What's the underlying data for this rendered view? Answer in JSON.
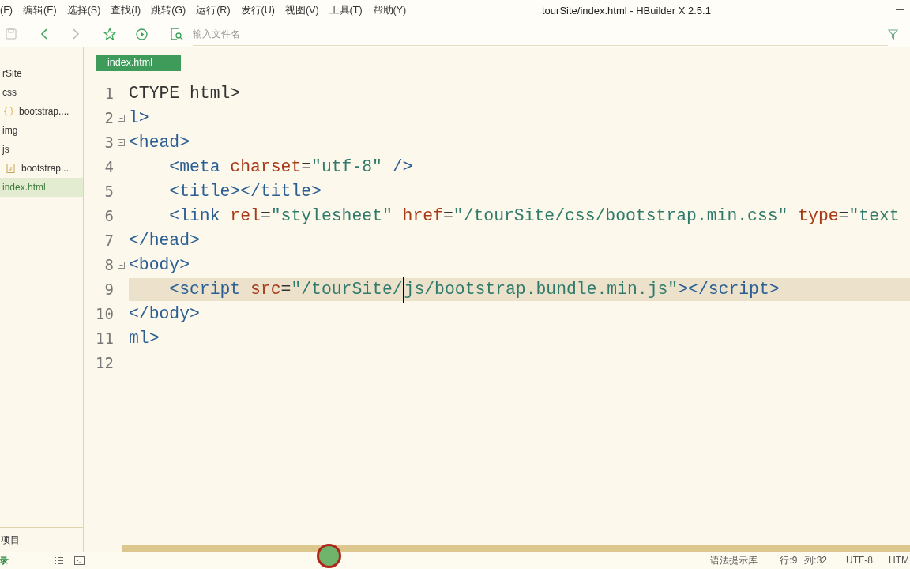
{
  "window": {
    "title": "tourSite/index.html - HBuilder X 2.5.1"
  },
  "menu": [
    "(F)",
    "编辑(E)",
    "选择(S)",
    "查找(I)",
    "跳转(G)",
    "运行(R)",
    "发行(U)",
    "视图(V)",
    "工具(T)",
    "帮助(Y)"
  ],
  "toolbar": {
    "items": [
      {
        "kind": "save",
        "disabled": true
      },
      {
        "kind": "back",
        "disabled": false
      },
      {
        "kind": "forward",
        "disabled": true
      },
      {
        "kind": "star",
        "disabled": false
      },
      {
        "kind": "run",
        "disabled": false
      }
    ],
    "search": {
      "placeholder": "输入文件名"
    }
  },
  "sidebar": {
    "tree": [
      {
        "label": "rSite",
        "selected": false,
        "children": [
          {
            "label": "css",
            "selected": false,
            "children": [
              {
                "label": "bootstrap....",
                "kind": "css",
                "selected": false
              }
            ]
          },
          {
            "label": "img",
            "selected": false
          },
          {
            "label": "js",
            "selected": false,
            "children": [
              {
                "label": "bootstrap....",
                "kind": "js",
                "selected": false
              }
            ]
          },
          {
            "label": "index.html",
            "selected": true
          }
        ]
      }
    ],
    "footer": "项目"
  },
  "editor": {
    "tabs": [
      {
        "label": "index.html",
        "selected": true
      }
    ],
    "lines": [
      {
        "number": "1",
        "fold": false,
        "current": false,
        "tokens": [
          {
            "t": "CTYPE html>",
            "kind": "plain"
          }
        ]
      },
      {
        "number": "2",
        "fold": true,
        "current": false,
        "tokens": [
          {
            "t": "l>",
            "kind": "tag"
          }
        ]
      },
      {
        "number": "3",
        "fold": true,
        "current": false,
        "tokens": [
          {
            "t": "<head>",
            "kind": "tag"
          }
        ]
      },
      {
        "number": "4",
        "fold": false,
        "current": false,
        "tokens": [
          {
            "t": "    <meta",
            "kind": "tag"
          },
          {
            "t": " charset",
            "kind": "attr"
          },
          {
            "t": "=",
            "kind": "plain"
          },
          {
            "t": "\"utf-8\"",
            "kind": "string"
          },
          {
            "t": " />",
            "kind": "tag"
          }
        ]
      },
      {
        "number": "5",
        "fold": false,
        "current": false,
        "tokens": [
          {
            "t": "    <title></title>",
            "kind": "tag"
          }
        ]
      },
      {
        "number": "6",
        "fold": false,
        "current": false,
        "tokens": [
          {
            "t": "    <link",
            "kind": "tag"
          },
          {
            "t": " rel",
            "kind": "attr"
          },
          {
            "t": "=",
            "kind": "plain"
          },
          {
            "t": "\"stylesheet\"",
            "kind": "string"
          },
          {
            "t": " href",
            "kind": "attr"
          },
          {
            "t": "=",
            "kind": "plain"
          },
          {
            "t": "\"/tourSite/css/bootstrap.min.css\"",
            "kind": "string"
          },
          {
            "t": " type",
            "kind": "attr"
          },
          {
            "t": "=",
            "kind": "plain"
          },
          {
            "t": "\"text",
            "kind": "string"
          }
        ]
      },
      {
        "number": "7",
        "fold": false,
        "current": false,
        "tokens": [
          {
            "t": "</head>",
            "kind": "tag"
          }
        ]
      },
      {
        "number": "8",
        "fold": true,
        "current": false,
        "tokens": [
          {
            "t": "<body>",
            "kind": "tag"
          }
        ]
      },
      {
        "number": "9",
        "fold": false,
        "current": true,
        "tokens": [
          {
            "t": "    <script",
            "kind": "tag",
            "caret": false
          },
          {
            "t": " src",
            "kind": "attr",
            "caret": false
          },
          {
            "t": "=",
            "kind": "plain",
            "caret": false
          },
          {
            "t": "\"/tourSite/",
            "kind": "string",
            "caret": true
          },
          {
            "t": "js/bootstrap.bundle.min.js\"",
            "kind": "string",
            "caret": false
          },
          {
            "t": "></script>",
            "kind": "tag",
            "caret": false
          }
        ]
      },
      {
        "number": "10",
        "fold": false,
        "current": false,
        "tokens": [
          {
            "t": "</body>",
            "kind": "tag"
          }
        ]
      },
      {
        "number": "11",
        "fold": false,
        "current": false,
        "tokens": [
          {
            "t": "ml>",
            "kind": "tag"
          }
        ]
      },
      {
        "number": "12",
        "fold": false,
        "current": false
      }
    ]
  },
  "status_bar": {
    "left": "录",
    "items": [
      "语法提示库",
      "行:9",
      "列:32",
      "UTF-8",
      "HTM"
    ]
  }
}
